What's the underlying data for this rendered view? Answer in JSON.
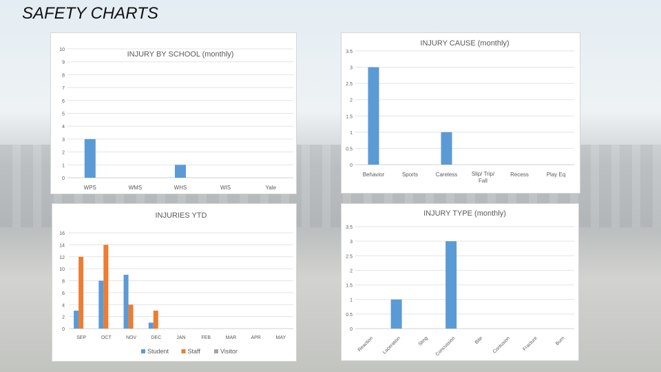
{
  "page_title": "SAFETY CHARTS",
  "colors": {
    "student": "#5b9bd5",
    "staff": "#ed7d31",
    "visitor": "#a5a5a5",
    "grid": "#e3e3e3"
  },
  "chart_data": [
    {
      "type": "bar",
      "title": "INJURY BY SCHOOL (monthly)",
      "categories": [
        "WPS",
        "WMS",
        "WHS",
        "WIS",
        "Yale"
      ],
      "series": [
        {
          "values": [
            3,
            0,
            1,
            0,
            0
          ]
        }
      ],
      "ylim": [
        0,
        10
      ],
      "ystep": 1,
      "grid": true,
      "legend": "none"
    },
    {
      "type": "bar",
      "title": "INJURY CAUSE (monthly)",
      "categories": [
        "Behavior",
        "Sports",
        "Careless",
        "Slip/ Trip/ Fall",
        "Recess",
        "Play Eq"
      ],
      "series": [
        {
          "values": [
            3,
            0,
            1,
            0,
            0,
            0
          ]
        }
      ],
      "ylim": [
        0,
        3.5
      ],
      "ystep": 0.5,
      "grid": true,
      "legend": "none"
    },
    {
      "type": "bar",
      "title": "INJURIES  YTD",
      "categories": [
        "SEP",
        "OCT",
        "NOV",
        "DEC",
        "JAN",
        "FEB",
        "MAR",
        "APR",
        "MAY"
      ],
      "series": [
        {
          "name": "Student",
          "values": [
            3,
            8,
            9,
            1,
            0,
            0,
            0,
            0,
            0
          ]
        },
        {
          "name": "Staff",
          "values": [
            12,
            14,
            4,
            3,
            0,
            0,
            0,
            0,
            0
          ]
        },
        {
          "name": "Visitor",
          "values": [
            0,
            0,
            0,
            0,
            0,
            0,
            0,
            0,
            0
          ]
        }
      ],
      "ylim": [
        0,
        16
      ],
      "ystep": 2,
      "grid": true,
      "legend": "bottom"
    },
    {
      "type": "bar",
      "title": "INJURY TYPE (monthly)",
      "categories": [
        "Reaction",
        "Laceration",
        "Sting",
        "Concussion",
        "Bite",
        "Contusion",
        "Fracture",
        "Burn"
      ],
      "series": [
        {
          "values": [
            0,
            1,
            0,
            3,
            0,
            0,
            0,
            0
          ]
        }
      ],
      "ylim": [
        0,
        3.5
      ],
      "ystep": 0.5,
      "grid": true,
      "legend": "none",
      "rotated_labels": true
    }
  ]
}
